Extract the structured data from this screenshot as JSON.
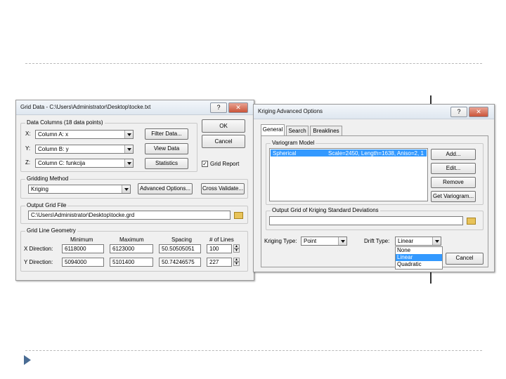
{
  "grid_data": {
    "title": "Grid Data - C:\\Users\\Administrator\\Desktop\\tocke.txt",
    "help_btn": "?",
    "close_btn": "✕",
    "data_columns": {
      "label": "Data Columns  (18 data points)",
      "x_label": "X:",
      "x_value": "Column A: x",
      "y_label": "Y:",
      "y_value": "Column B: y",
      "z_label": "Z:",
      "z_value": "Column C: funkcija",
      "filter_btn": "Filter Data...",
      "view_btn": "View Data",
      "stats_btn": "Statistics"
    },
    "ok_btn": "OK",
    "cancel_btn": "Cancel",
    "grid_report_label": "Grid Report",
    "grid_report_checked": true,
    "gridding_method": {
      "label": "Gridding Method",
      "value": "Kriging",
      "advanced_btn": "Advanced Options...",
      "cross_btn": "Cross Validate..."
    },
    "output_grid_file": {
      "label": "Output Grid File",
      "value": "C:\\Users\\Administrator\\Desktop\\tocke.grd"
    },
    "grid_line_geometry": {
      "label": "Grid Line Geometry",
      "headers": [
        "Minimum",
        "Maximum",
        "Spacing",
        "# of Lines"
      ],
      "x_row_label": "X Direction:",
      "x_values": [
        "6118000",
        "6123000",
        "50.50505051",
        "100"
      ],
      "y_row_label": "Y Direction:",
      "y_values": [
        "5094000",
        "5101400",
        "50.74246575",
        "227"
      ]
    }
  },
  "kriging": {
    "title": "Kriging Advanced Options",
    "help_btn": "?",
    "close_btn": "✕",
    "tabs": [
      "General",
      "Search",
      "Breaklines"
    ],
    "variogram_model": {
      "label": "Variogram Model",
      "item_name": "Spherical",
      "item_params": "Scale=2450, Length=1638, Aniso=2, 1",
      "add_btn": "Add...",
      "edit_btn": "Edit...",
      "remove_btn": "Remove",
      "get_btn": "Get Variogram..."
    },
    "output_std_label": "Output Grid of Kriging Standard Deviations",
    "output_std_value": "",
    "kriging_type_label": "Kriging Type:",
    "kriging_type_value": "Point",
    "drift_type_label": "Drift Type:",
    "drift_type_value": "Linear",
    "drift_options": [
      "None",
      "Linear",
      "Quadratic"
    ],
    "drift_selected_index": 1,
    "cancel_btn": "Cancel"
  },
  "colors": {
    "selection": "#3399ff",
    "slide_bullet": "#4a6c94"
  }
}
